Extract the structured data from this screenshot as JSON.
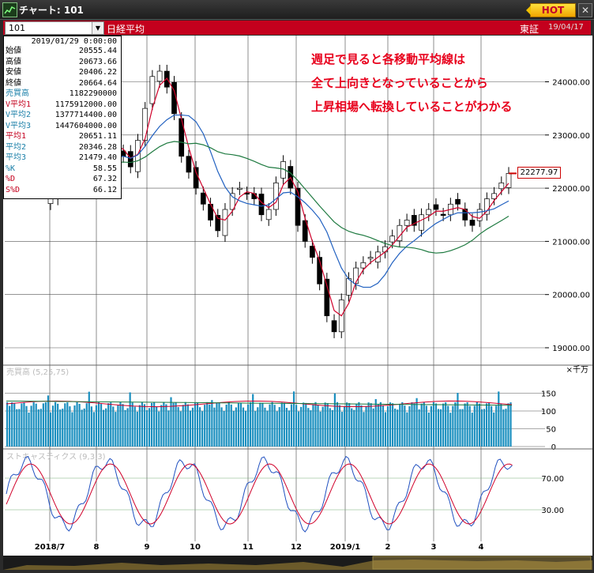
{
  "window": {
    "title": "チャート: 101",
    "hot_label": "HOT",
    "close_label": "✕"
  },
  "toolbar": {
    "symbol": "101",
    "instrument": "日経平均",
    "exchange": "東証",
    "date": "19/04/17"
  },
  "info": {
    "date": "2019/01/29 0:00:00",
    "rows": [
      {
        "label": "始値",
        "value": "20555.44",
        "color": "#000000"
      },
      {
        "label": "高値",
        "value": "20673.66",
        "color": "#000000"
      },
      {
        "label": "安値",
        "value": "20406.22",
        "color": "#000000"
      },
      {
        "label": "終値",
        "value": "20664.64",
        "color": "#000000"
      },
      {
        "label": "売買高",
        "value": "1182290000",
        "color": "#1a7fa8"
      },
      {
        "label": "V平均1",
        "value": "1175912000.00",
        "color": "#c4001d"
      },
      {
        "label": "V平均2",
        "value": "1377714400.00",
        "color": "#1a7fa8"
      },
      {
        "label": "V平均3",
        "value": "1447604000.00",
        "color": "#1a7fa8"
      },
      {
        "label": "平均1",
        "value": "20651.11",
        "color": "#c4001d"
      },
      {
        "label": "平均2",
        "value": "20346.28",
        "color": "#1a7fa8"
      },
      {
        "label": "平均3",
        "value": "21479.40",
        "color": "#1a7fa8"
      },
      {
        "label": "%K",
        "value": "58.55",
        "color": "#1a7fa8"
      },
      {
        "label": "%D",
        "value": "67.32",
        "color": "#c4001d"
      },
      {
        "label": "S%D",
        "value": "66.12",
        "color": "#c4001d"
      }
    ]
  },
  "annotation": [
    "週足で見ると各移動平均線は",
    "全て上向きとなっていることから",
    "上昇相場へ転換していることがわかる"
  ],
  "last_price": "22277.97",
  "colors": {
    "up": "#ffffff",
    "down": "#000000",
    "ma1": "#d0002a",
    "ma2": "#2060c0",
    "ma3": "#1e7a40",
    "volume": "#1a8fbf",
    "stoch_k": "#2050c0",
    "stoch_d": "#d0002a"
  },
  "chart_data": [
    {
      "type": "candlestick",
      "title": "日経平均",
      "y_ticks": [
        19000,
        20000,
        21000,
        22000,
        23000,
        24000
      ],
      "y_tick_labels": [
        "19000.00",
        "20000.00",
        "21000.00",
        "22000.00",
        "23000.00",
        "24000.00"
      ],
      "x_tick_labels": [
        "2018/7",
        "8",
        "9",
        "10",
        "11",
        "12",
        "2019/1",
        "2",
        "3",
        "4"
      ],
      "series": [
        {
          "name": "price",
          "close_approx": [
            21800,
            22300,
            22500,
            22700,
            22400,
            22200,
            22500,
            22800,
            22900,
            22700,
            22600,
            22400,
            22900,
            23500,
            24100,
            24200,
            23900,
            23400,
            22600,
            22300,
            22000,
            21700,
            21400,
            21200,
            21600,
            21900,
            22000,
            21900,
            21800,
            21500,
            21600,
            22100,
            22500,
            22000,
            21300,
            21000,
            20700,
            20200,
            19600,
            19300,
            19900,
            20300,
            20500,
            20600,
            20700,
            20800,
            20900,
            21100,
            21300,
            21400,
            21300,
            21500,
            21600,
            21600,
            21500,
            21700,
            21700,
            21400,
            21300,
            21600,
            21800,
            21900,
            22100,
            22277.97
          ]
        }
      ]
    },
    {
      "type": "bar",
      "title": "売買高 (5,25,75)",
      "unit": "×千万",
      "y_ticks": [
        0,
        50,
        100,
        150
      ],
      "y_tick_labels": [
        "0",
        "50",
        "100",
        "150"
      ]
    },
    {
      "type": "line",
      "title": "ストキャスティクス (9,3,3)",
      "y_ticks": [
        30,
        70
      ],
      "y_tick_labels": [
        "30.00",
        "70.00"
      ]
    }
  ]
}
